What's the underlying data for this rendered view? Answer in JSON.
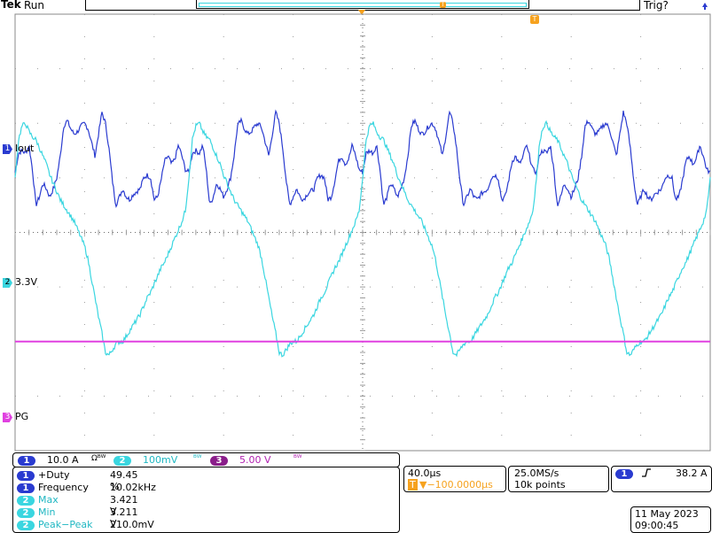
{
  "header": {
    "brand": "Tek",
    "acq_state": "Run",
    "trigger_status": "Trig?",
    "trigger_marker": "T",
    "record_position_marker": "T"
  },
  "channels": {
    "ch1": {
      "number": "1",
      "label": "Iout",
      "color": "#2a3bd0",
      "scale": "10.0 A",
      "suffix": "Ωᴮᵂ"
    },
    "ch2": {
      "number": "2",
      "label": "3.3V",
      "color": "#3ad6e0",
      "scale": "100mV",
      "suffix": "ᴮᵂ"
    },
    "ch3": {
      "number": "3",
      "label": "PG",
      "color": "#e040e0",
      "scale": "5.00 V",
      "suffix": "ᴮᵂ"
    }
  },
  "measurements": [
    {
      "ch": "1",
      "name": "+Duty",
      "value": "49.45 %"
    },
    {
      "ch": "1",
      "name": "Frequency",
      "value": "10.02kHz"
    },
    {
      "ch": "2",
      "name": "Max",
      "value": "3.421 V"
    },
    {
      "ch": "2",
      "name": "Min",
      "value": "3.211 V"
    },
    {
      "ch": "2",
      "name": "Peak−Peak",
      "value": "210.0mV"
    }
  ],
  "timebase": {
    "scale": "40.0µs",
    "delay": "▼−100.0000µs",
    "delay_icon": "T"
  },
  "acquisition": {
    "sample_rate": "25.0MS/s",
    "record_length": "10k points"
  },
  "trigger": {
    "source": "1",
    "slope_icon": "rising-edge-icon",
    "level": "38.2 A"
  },
  "datetime": {
    "date": "11 May 2023",
    "time": "09:00:45"
  },
  "chart_data": {
    "type": "line",
    "x_divisions": 10,
    "y_divisions": 8,
    "grid": true,
    "period_divisions": 2.5,
    "series": [
      {
        "name": "Iout",
        "ch": "1",
        "color": "#2a3bd0",
        "shape_y_div": [
          -0.9,
          -0.55,
          -0.5,
          -0.55,
          -0.4,
          -0.85,
          -1.5,
          -1.35,
          -1.1,
          -1.2,
          -1.35,
          -1.2,
          -1.0,
          -0.6,
          -0.05,
          0.05,
          -0.1,
          -0.2,
          -0.15,
          -0.05,
          0.0,
          -0.1,
          -0.35,
          -0.6,
          -0.2,
          0.2,
          0.0,
          -0.45,
          -1.05,
          -1.5,
          -1.35,
          -1.2,
          -1.35,
          -1.4,
          -1.3,
          -1.25,
          -1.2,
          -1.0,
          -0.95,
          -1.0,
          -1.4,
          -1.35,
          -1.05,
          -0.7,
          -0.6,
          -0.75,
          -0.65,
          -0.4,
          -0.6,
          -0.85
        ]
      },
      {
        "name": "3.3V",
        "ch": "2",
        "color": "#3ad6e0",
        "shape_y_div": [
          2.0,
          2.7,
          2.95,
          3.0,
          2.85,
          2.75,
          2.7,
          2.55,
          2.4,
          2.25,
          2.05,
          1.9,
          1.75,
          1.6,
          1.5,
          1.4,
          1.3,
          1.2,
          1.05,
          0.9,
          0.75,
          0.5,
          0.15,
          -0.2,
          -0.55,
          -0.85,
          -1.2,
          -1.25,
          -1.15,
          -1.05,
          -1.0,
          -1.0,
          -0.9,
          -0.8,
          -0.7,
          -0.6,
          -0.5,
          -0.35,
          -0.2,
          -0.1,
          0.05,
          0.2,
          0.35,
          0.45,
          0.6,
          0.75,
          0.9,
          1.05,
          1.2,
          1.4
        ]
      },
      {
        "name": "PG",
        "ch": "3",
        "color": "#e040e0",
        "shape_y_div": [
          0.0
        ]
      }
    ],
    "ref_levels_div": {
      "Iout": 2.0,
      "3.3V": -1.0,
      "PG": -4.0
    },
    "trace_offsets_div": {
      "Iout": 2.0,
      "3.3V": -1.0,
      "PG": -2.0
    }
  }
}
